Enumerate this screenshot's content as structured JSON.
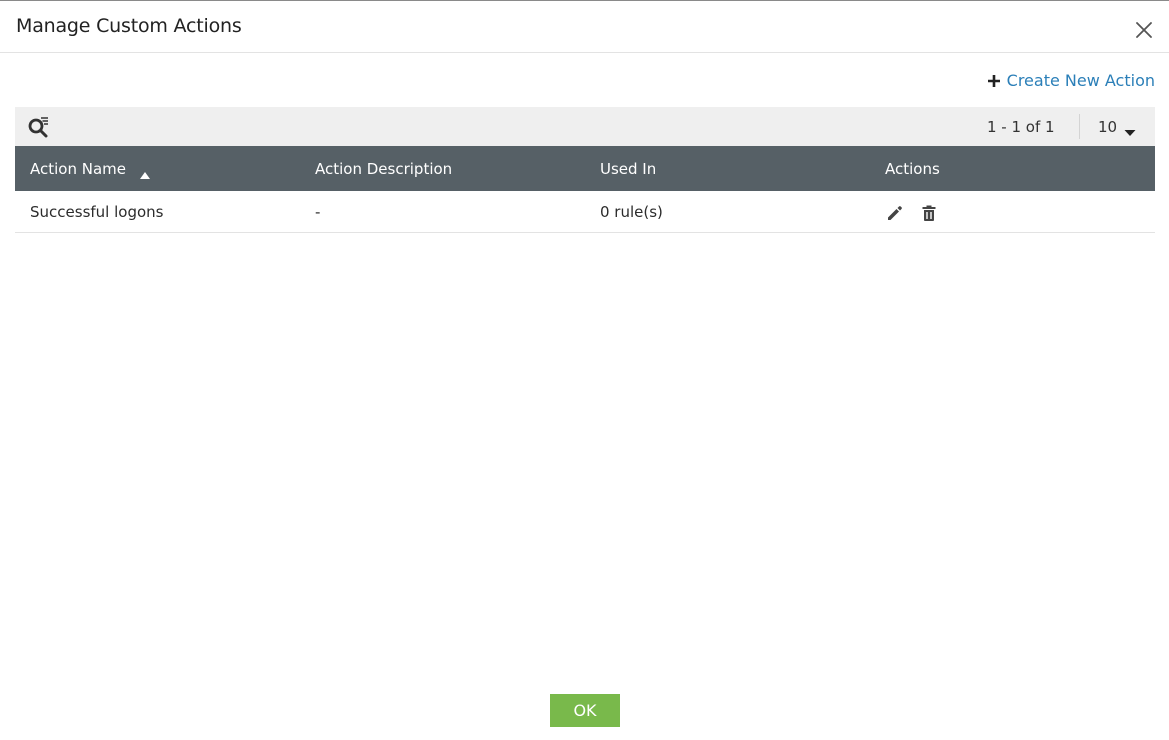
{
  "dialog": {
    "title": "Manage Custom Actions",
    "close_icon": "close-icon"
  },
  "toolbar": {
    "create_label": "Create New Action",
    "create_icon": "plus-icon",
    "search_icon": "search-filter-icon",
    "pagination": "1 - 1 of 1",
    "page_size": "10"
  },
  "table": {
    "columns": [
      "Action Name",
      "Action Description",
      "Used In",
      "Actions"
    ],
    "sort": {
      "column": "Action Name",
      "direction": "ascending"
    },
    "rows": [
      {
        "name": "Successful logons",
        "description": "-",
        "used_in": "0 rule(s)",
        "actions": [
          "edit-icon",
          "delete-icon"
        ]
      }
    ]
  },
  "footer": {
    "ok_label": "OK"
  },
  "colors": {
    "header_bg": "#566066",
    "toolbar_bg": "#efefef",
    "link": "#2b7fb8",
    "ok_button": "#79b94b"
  }
}
